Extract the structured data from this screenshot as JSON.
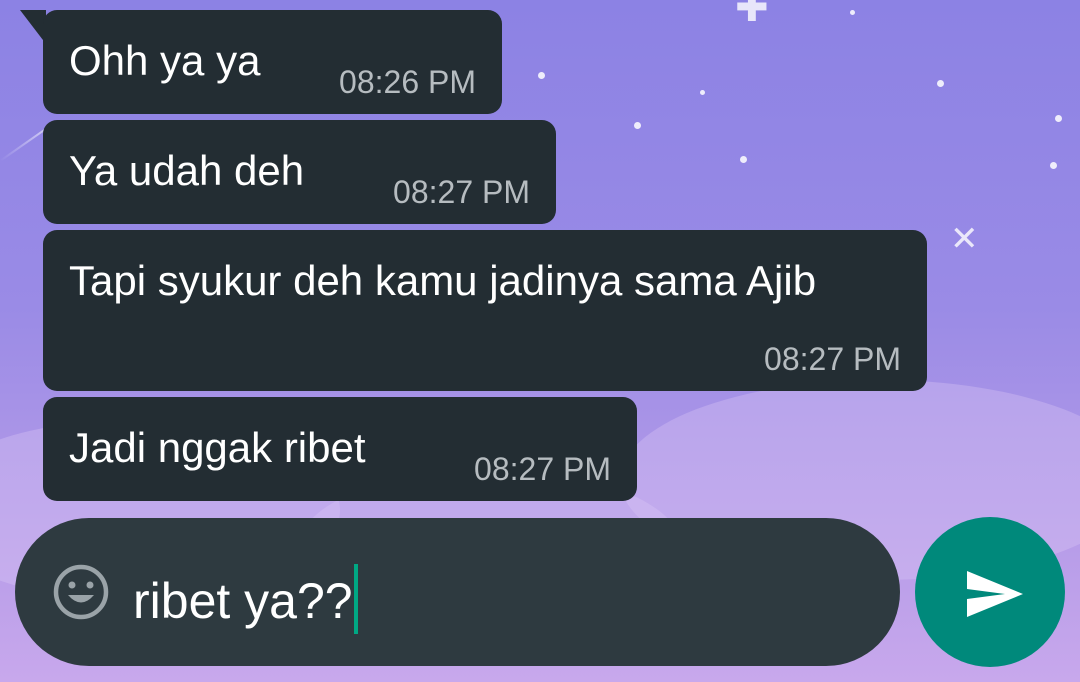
{
  "colors": {
    "bubble_bg": "#232d33",
    "timestamp": "#b6bcc0",
    "input_bg": "#2e3a40",
    "send_button": "#00897b",
    "caret": "#00a884",
    "wallpaper_top": "#8c82e4",
    "wallpaper_bottom": "#c8a8ec"
  },
  "messages": [
    {
      "text": "Ohh ya ya",
      "time": "08:26 PM"
    },
    {
      "text": "Ya udah deh",
      "time": "08:27 PM"
    },
    {
      "text": "Tapi syukur deh kamu jadinya sama Ajib",
      "time": "08:27 PM"
    },
    {
      "text": "Jadi nggak ribet",
      "time": "08:27 PM"
    }
  ],
  "composer": {
    "emoji_icon": "smiley-face-icon",
    "value": "ribet ya??",
    "send_icon": "send-arrow-icon"
  }
}
